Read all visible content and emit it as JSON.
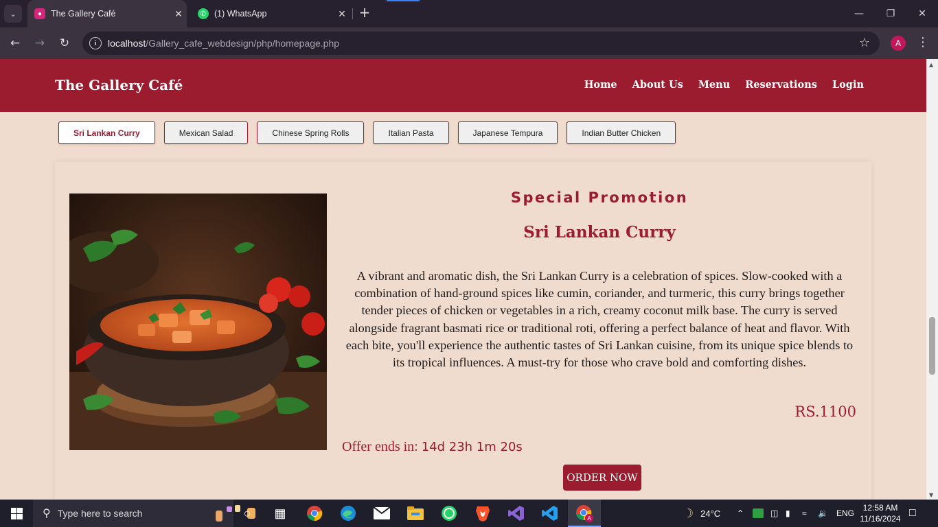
{
  "browser": {
    "tabs": [
      {
        "title": "The Gallery Café",
        "active": true
      },
      {
        "title": "(1) WhatsApp",
        "active": false
      }
    ],
    "url_host": "localhost",
    "url_path": "/Gallery_cafe_webdesign/php/homepage.php",
    "profile_initial": "A"
  },
  "site": {
    "title": "The Gallery Café",
    "nav": [
      "Home",
      "About Us",
      "Menu",
      "Reservations",
      "Login"
    ],
    "brand_color": "#9b1c2f",
    "background_color": "#efdccf"
  },
  "dish_tabs": [
    {
      "label": "Sri Lankan Curry",
      "active": true
    },
    {
      "label": "Mexican Salad",
      "active": false
    },
    {
      "label": "Chinese Spring Rolls",
      "active": false
    },
    {
      "label": "Italian Pasta",
      "active": false
    },
    {
      "label": "Japanese Tempura",
      "active": false
    },
    {
      "label": "Indian Butter Chicken",
      "active": false
    }
  ],
  "promotion": {
    "heading": "Special Promotion",
    "dish_name": "Sri Lankan Curry",
    "description": "A vibrant and aromatic dish, the Sri Lankan Curry is a celebration of spices. Slow-cooked with a combination of hand-ground spices like cumin, coriander, and turmeric, this curry brings together tender pieces of chicken or vegetables in a rich, creamy coconut milk base. The curry is served alongside fragrant basmati rice or traditional roti, offering a perfect balance of heat and flavor. With each bite, you'll experience the authentic tastes of Sri Lankan cuisine, from its unique spice blends to its tropical influences. A must-try for those who crave bold and comforting dishes.",
    "price": "RS.1100",
    "offer_label": "Offer ends in:",
    "countdown": "14d 23h 1m 20s",
    "order_button": "ORDER NOW"
  },
  "taskbar": {
    "search_placeholder": "Type here to search",
    "weather": "24°C",
    "language": "ENG",
    "time": "12:58 AM",
    "date": "11/16/2024"
  }
}
